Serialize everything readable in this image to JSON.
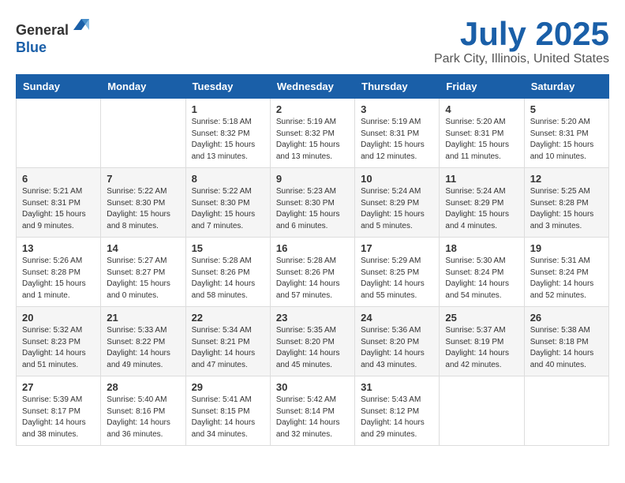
{
  "header": {
    "logo_line1": "General",
    "logo_line2": "Blue",
    "month": "July 2025",
    "location": "Park City, Illinois, United States"
  },
  "weekdays": [
    "Sunday",
    "Monday",
    "Tuesday",
    "Wednesday",
    "Thursday",
    "Friday",
    "Saturday"
  ],
  "weeks": [
    [
      {
        "day": "",
        "sunrise": "",
        "sunset": "",
        "daylight": ""
      },
      {
        "day": "",
        "sunrise": "",
        "sunset": "",
        "daylight": ""
      },
      {
        "day": "1",
        "sunrise": "Sunrise: 5:18 AM",
        "sunset": "Sunset: 8:32 PM",
        "daylight": "Daylight: 15 hours and 13 minutes."
      },
      {
        "day": "2",
        "sunrise": "Sunrise: 5:19 AM",
        "sunset": "Sunset: 8:32 PM",
        "daylight": "Daylight: 15 hours and 13 minutes."
      },
      {
        "day": "3",
        "sunrise": "Sunrise: 5:19 AM",
        "sunset": "Sunset: 8:31 PM",
        "daylight": "Daylight: 15 hours and 12 minutes."
      },
      {
        "day": "4",
        "sunrise": "Sunrise: 5:20 AM",
        "sunset": "Sunset: 8:31 PM",
        "daylight": "Daylight: 15 hours and 11 minutes."
      },
      {
        "day": "5",
        "sunrise": "Sunrise: 5:20 AM",
        "sunset": "Sunset: 8:31 PM",
        "daylight": "Daylight: 15 hours and 10 minutes."
      }
    ],
    [
      {
        "day": "6",
        "sunrise": "Sunrise: 5:21 AM",
        "sunset": "Sunset: 8:31 PM",
        "daylight": "Daylight: 15 hours and 9 minutes."
      },
      {
        "day": "7",
        "sunrise": "Sunrise: 5:22 AM",
        "sunset": "Sunset: 8:30 PM",
        "daylight": "Daylight: 15 hours and 8 minutes."
      },
      {
        "day": "8",
        "sunrise": "Sunrise: 5:22 AM",
        "sunset": "Sunset: 8:30 PM",
        "daylight": "Daylight: 15 hours and 7 minutes."
      },
      {
        "day": "9",
        "sunrise": "Sunrise: 5:23 AM",
        "sunset": "Sunset: 8:30 PM",
        "daylight": "Daylight: 15 hours and 6 minutes."
      },
      {
        "day": "10",
        "sunrise": "Sunrise: 5:24 AM",
        "sunset": "Sunset: 8:29 PM",
        "daylight": "Daylight: 15 hours and 5 minutes."
      },
      {
        "day": "11",
        "sunrise": "Sunrise: 5:24 AM",
        "sunset": "Sunset: 8:29 PM",
        "daylight": "Daylight: 15 hours and 4 minutes."
      },
      {
        "day": "12",
        "sunrise": "Sunrise: 5:25 AM",
        "sunset": "Sunset: 8:28 PM",
        "daylight": "Daylight: 15 hours and 3 minutes."
      }
    ],
    [
      {
        "day": "13",
        "sunrise": "Sunrise: 5:26 AM",
        "sunset": "Sunset: 8:28 PM",
        "daylight": "Daylight: 15 hours and 1 minute."
      },
      {
        "day": "14",
        "sunrise": "Sunrise: 5:27 AM",
        "sunset": "Sunset: 8:27 PM",
        "daylight": "Daylight: 15 hours and 0 minutes."
      },
      {
        "day": "15",
        "sunrise": "Sunrise: 5:28 AM",
        "sunset": "Sunset: 8:26 PM",
        "daylight": "Daylight: 14 hours and 58 minutes."
      },
      {
        "day": "16",
        "sunrise": "Sunrise: 5:28 AM",
        "sunset": "Sunset: 8:26 PM",
        "daylight": "Daylight: 14 hours and 57 minutes."
      },
      {
        "day": "17",
        "sunrise": "Sunrise: 5:29 AM",
        "sunset": "Sunset: 8:25 PM",
        "daylight": "Daylight: 14 hours and 55 minutes."
      },
      {
        "day": "18",
        "sunrise": "Sunrise: 5:30 AM",
        "sunset": "Sunset: 8:24 PM",
        "daylight": "Daylight: 14 hours and 54 minutes."
      },
      {
        "day": "19",
        "sunrise": "Sunrise: 5:31 AM",
        "sunset": "Sunset: 8:24 PM",
        "daylight": "Daylight: 14 hours and 52 minutes."
      }
    ],
    [
      {
        "day": "20",
        "sunrise": "Sunrise: 5:32 AM",
        "sunset": "Sunset: 8:23 PM",
        "daylight": "Daylight: 14 hours and 51 minutes."
      },
      {
        "day": "21",
        "sunrise": "Sunrise: 5:33 AM",
        "sunset": "Sunset: 8:22 PM",
        "daylight": "Daylight: 14 hours and 49 minutes."
      },
      {
        "day": "22",
        "sunrise": "Sunrise: 5:34 AM",
        "sunset": "Sunset: 8:21 PM",
        "daylight": "Daylight: 14 hours and 47 minutes."
      },
      {
        "day": "23",
        "sunrise": "Sunrise: 5:35 AM",
        "sunset": "Sunset: 8:20 PM",
        "daylight": "Daylight: 14 hours and 45 minutes."
      },
      {
        "day": "24",
        "sunrise": "Sunrise: 5:36 AM",
        "sunset": "Sunset: 8:20 PM",
        "daylight": "Daylight: 14 hours and 43 minutes."
      },
      {
        "day": "25",
        "sunrise": "Sunrise: 5:37 AM",
        "sunset": "Sunset: 8:19 PM",
        "daylight": "Daylight: 14 hours and 42 minutes."
      },
      {
        "day": "26",
        "sunrise": "Sunrise: 5:38 AM",
        "sunset": "Sunset: 8:18 PM",
        "daylight": "Daylight: 14 hours and 40 minutes."
      }
    ],
    [
      {
        "day": "27",
        "sunrise": "Sunrise: 5:39 AM",
        "sunset": "Sunset: 8:17 PM",
        "daylight": "Daylight: 14 hours and 38 minutes."
      },
      {
        "day": "28",
        "sunrise": "Sunrise: 5:40 AM",
        "sunset": "Sunset: 8:16 PM",
        "daylight": "Daylight: 14 hours and 36 minutes."
      },
      {
        "day": "29",
        "sunrise": "Sunrise: 5:41 AM",
        "sunset": "Sunset: 8:15 PM",
        "daylight": "Daylight: 14 hours and 34 minutes."
      },
      {
        "day": "30",
        "sunrise": "Sunrise: 5:42 AM",
        "sunset": "Sunset: 8:14 PM",
        "daylight": "Daylight: 14 hours and 32 minutes."
      },
      {
        "day": "31",
        "sunrise": "Sunrise: 5:43 AM",
        "sunset": "Sunset: 8:12 PM",
        "daylight": "Daylight: 14 hours and 29 minutes."
      },
      {
        "day": "",
        "sunrise": "",
        "sunset": "",
        "daylight": ""
      },
      {
        "day": "",
        "sunrise": "",
        "sunset": "",
        "daylight": ""
      }
    ]
  ]
}
